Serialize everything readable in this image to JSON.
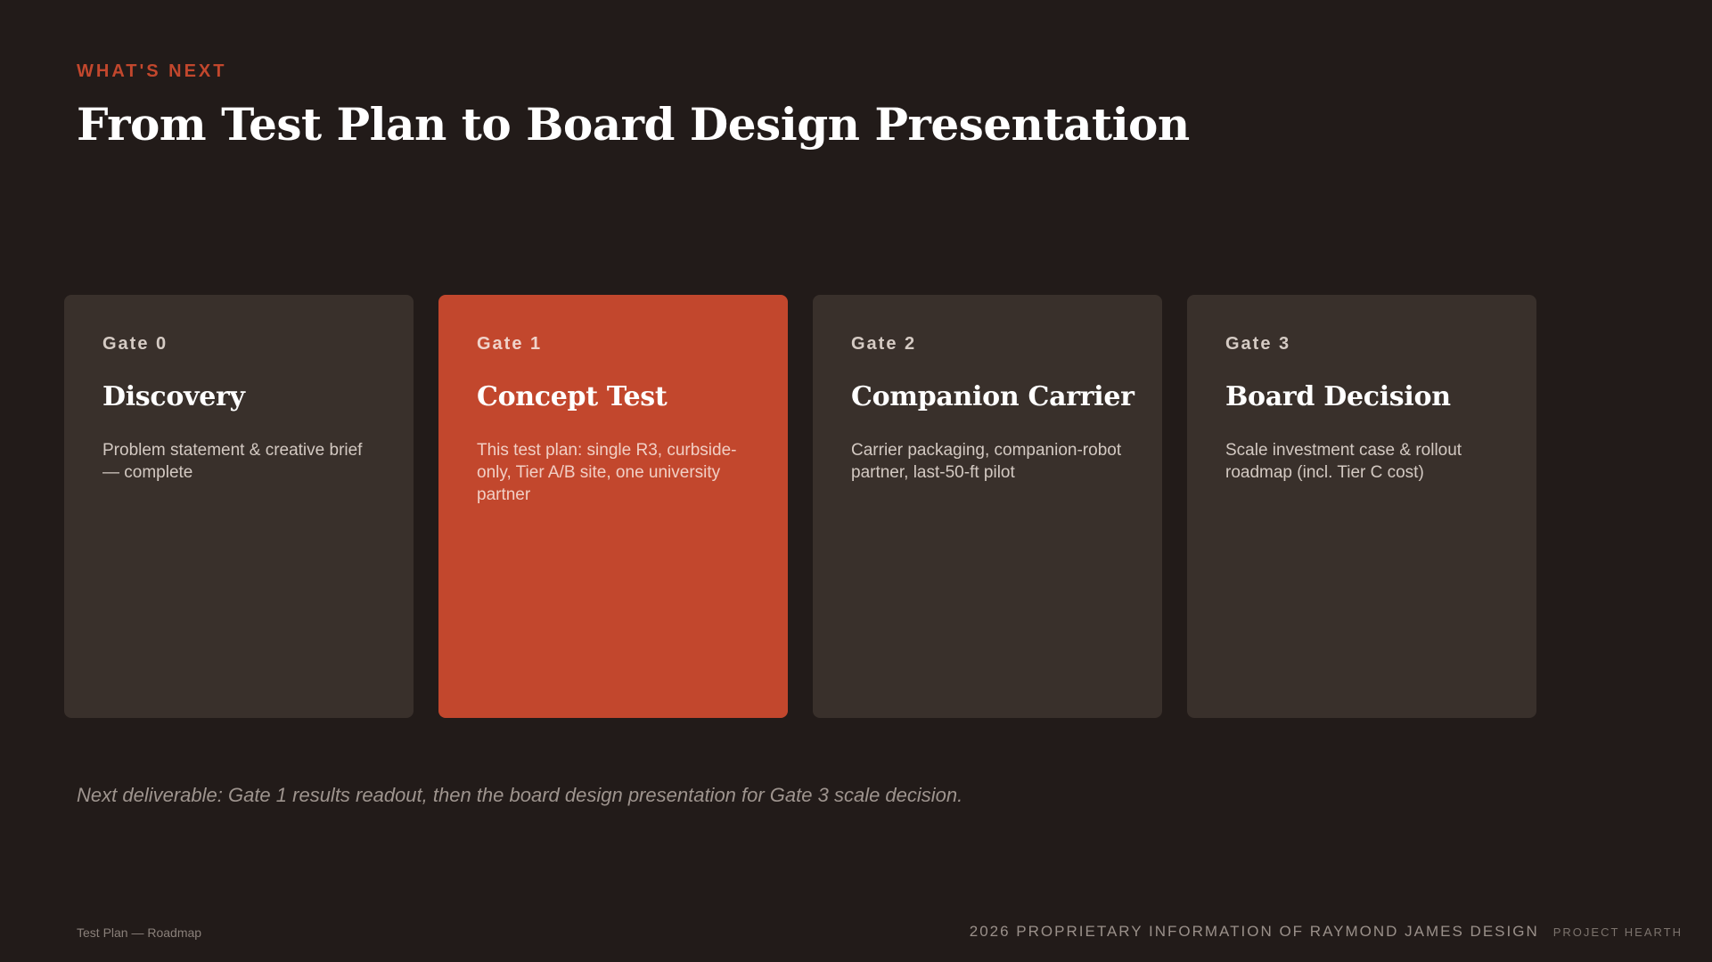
{
  "header": {
    "eyebrow": "WHAT'S NEXT",
    "title": "From Test Plan to Board Design Presentation"
  },
  "gates": [
    {
      "gate": "Gate 0",
      "title": "Discovery",
      "description": "Problem statement & creative brief — complete"
    },
    {
      "gate": "Gate 1",
      "title": "Concept Test",
      "description": "This test plan: single R3, curbside-only, Tier A/B site, one university partner"
    },
    {
      "gate": "Gate 2",
      "title": "Companion Carrier",
      "description": "Carrier packaging, companion-robot partner, last-50-ft pilot"
    },
    {
      "gate": "Gate 3",
      "title": "Board Decision",
      "description": "Scale investment case & rollout roadmap (incl. Tier C cost)"
    }
  ],
  "next_deliverable": "Next deliverable: Gate 1 results readout, then the board design presentation for Gate 3 scale decision.",
  "footer": {
    "section": "Test Plan — Roadmap",
    "proprietary": "2026 PROPRIETARY INFORMATION OF RAYMOND JAMES DESIGN",
    "project": "PROJECT HEARTH"
  },
  "colors": {
    "background": "#221b19",
    "card": "#39302b",
    "accent": "#c2472d"
  }
}
